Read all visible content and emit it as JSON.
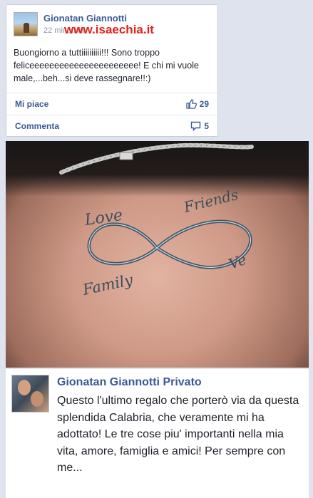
{
  "post": {
    "author": "Gionatan Giannotti",
    "time": "22 minuti fa",
    "text": "Buongiorno a tuttiiiiiiiiii!!! Sono troppo feliceeeeeeeeeeeeeeeeeeeeee! E chi mi vuole male,...beh...si deve rassegnare!!:)",
    "like_label": "Mi piace",
    "like_count": "29",
    "comment_label": "Commenta",
    "comment_count": "5"
  },
  "watermark": "www.isaechia.it",
  "photo": {
    "tattoo_words": [
      "Love",
      "Friends",
      "Family",
      "Ve"
    ]
  },
  "repost": {
    "author": "Gionatan Giannotti Privato",
    "text": "Questo l'ultimo regalo che porterò via da questa splendida Calabria, che veramente mi ha adottato! Le tre cose piu' importanti nella mia vita, amore, famiglia e amici! Per sempre con me..."
  },
  "colors": {
    "link_blue": "#3b5998",
    "watermark_red": "#e0241b",
    "background": "#dfe3ee"
  }
}
